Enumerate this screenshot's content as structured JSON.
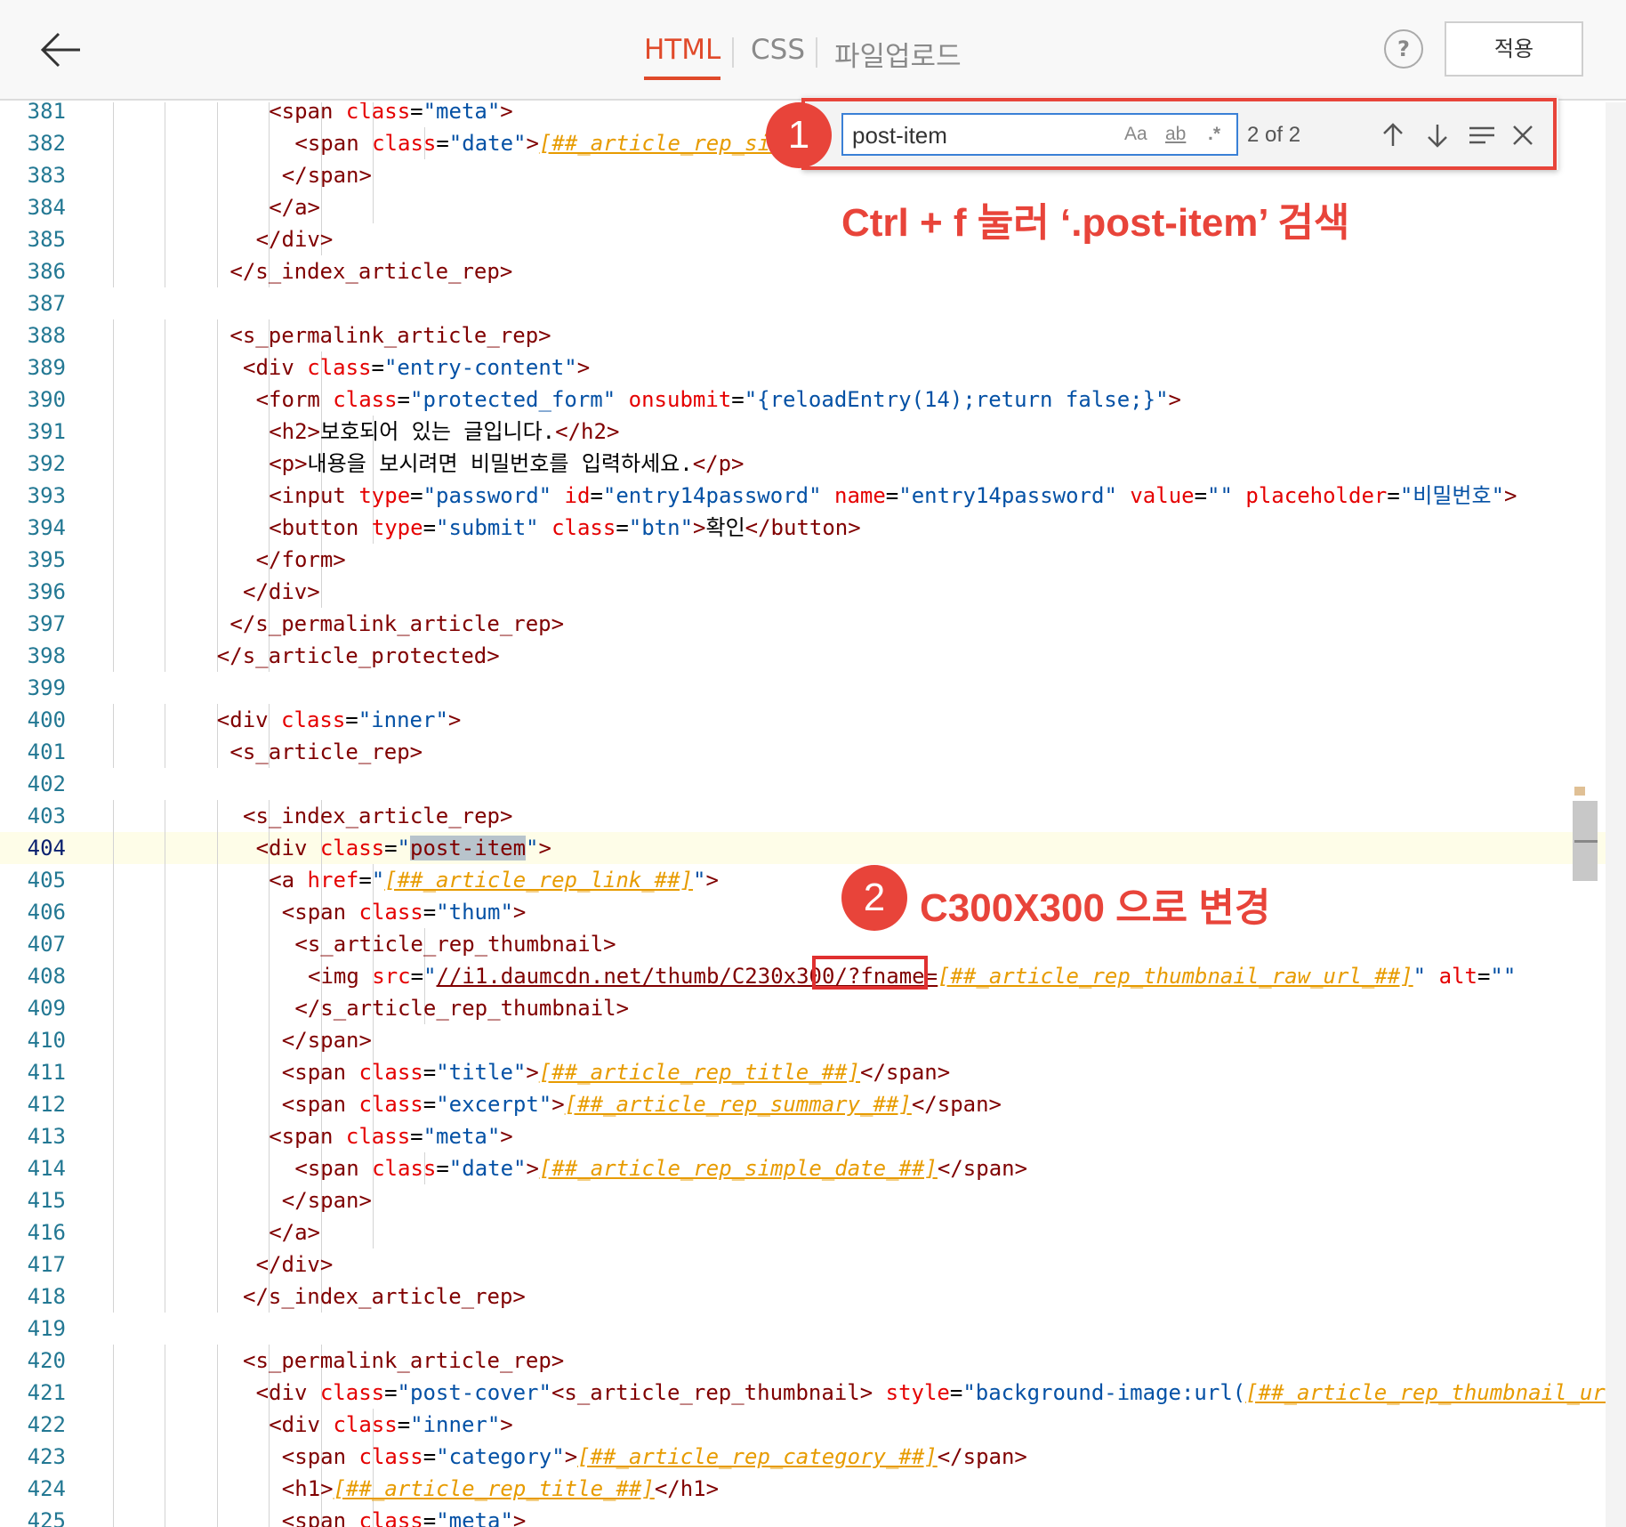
{
  "header": {
    "back_icon": "arrow-left-icon",
    "tabs": [
      {
        "label": "HTML",
        "active": true
      },
      {
        "label": "CSS",
        "active": false
      },
      {
        "label": "파일업로드",
        "active": false
      }
    ],
    "help_label": "?",
    "apply_label": "적용"
  },
  "find": {
    "query": "post-item",
    "match_case": "Aa",
    "whole_word": "ab",
    "regex": ".*",
    "count": "2 of 2",
    "icons": [
      "arrow-up-icon",
      "arrow-down-icon",
      "find-in-selection-icon",
      "close-icon"
    ]
  },
  "annotations": {
    "step1_number": "1",
    "step1_text": "Ctrl + f 눌러 ‘.post-item’ 검색",
    "step2_number": "2",
    "step2_text": "C300X300 으로 변경"
  },
  "editor": {
    "active_line": 404,
    "lines": [
      {
        "n": "381",
        "indent": 12,
        "tokens": [
          [
            "t",
            "<span "
          ],
          [
            "a",
            "class"
          ],
          [
            "p",
            "="
          ],
          [
            "s",
            "\"meta\""
          ],
          [
            "t",
            ">"
          ]
        ]
      },
      {
        "n": "382",
        "indent": 14,
        "tokens": [
          [
            "t",
            "<span "
          ],
          [
            "a",
            "class"
          ],
          [
            "p",
            "="
          ],
          [
            "s",
            "\"date\""
          ],
          [
            "t",
            ">"
          ],
          [
            "tp",
            "[##_article_rep_simple_date_##]"
          ],
          [
            "t",
            "</span>"
          ]
        ]
      },
      {
        "n": "383",
        "indent": 13,
        "tokens": [
          [
            "t",
            "</span>"
          ]
        ]
      },
      {
        "n": "384",
        "indent": 12,
        "tokens": [
          [
            "t",
            "</a>"
          ]
        ]
      },
      {
        "n": "385",
        "indent": 11,
        "tokens": [
          [
            "t",
            "</div>"
          ]
        ]
      },
      {
        "n": "386",
        "indent": 9,
        "tokens": [
          [
            "t",
            "</s_index_article_rep>"
          ]
        ]
      },
      {
        "n": "387",
        "indent": 0,
        "tokens": []
      },
      {
        "n": "388",
        "indent": 9,
        "tokens": [
          [
            "t",
            "<s_permalink_article_rep>"
          ]
        ]
      },
      {
        "n": "389",
        "indent": 10,
        "tokens": [
          [
            "t",
            "<div "
          ],
          [
            "a",
            "class"
          ],
          [
            "p",
            "="
          ],
          [
            "s",
            "\"entry-content\""
          ],
          [
            "t",
            ">"
          ]
        ]
      },
      {
        "n": "390",
        "indent": 11,
        "tokens": [
          [
            "t",
            "<form "
          ],
          [
            "a",
            "class"
          ],
          [
            "p",
            "="
          ],
          [
            "s",
            "\"protected_form\""
          ],
          [
            "p",
            " "
          ],
          [
            "a",
            "onsubmit"
          ],
          [
            "p",
            "="
          ],
          [
            "s",
            "\"{reloadEntry(14);return false;}\""
          ],
          [
            "t",
            ">"
          ]
        ]
      },
      {
        "n": "391",
        "indent": 12,
        "tokens": [
          [
            "t",
            "<h2>"
          ],
          [
            "p",
            "보호되어 있는 글입니다."
          ],
          [
            "t",
            "</h2>"
          ]
        ]
      },
      {
        "n": "392",
        "indent": 12,
        "tokens": [
          [
            "t",
            "<p>"
          ],
          [
            "p",
            "내용을 보시려면 비밀번호를 입력하세요."
          ],
          [
            "t",
            "</p>"
          ]
        ]
      },
      {
        "n": "393",
        "indent": 12,
        "tokens": [
          [
            "t",
            "<input "
          ],
          [
            "a",
            "type"
          ],
          [
            "p",
            "="
          ],
          [
            "s",
            "\"password\""
          ],
          [
            "p",
            " "
          ],
          [
            "a",
            "id"
          ],
          [
            "p",
            "="
          ],
          [
            "s",
            "\"entry14password\""
          ],
          [
            "p",
            " "
          ],
          [
            "a",
            "name"
          ],
          [
            "p",
            "="
          ],
          [
            "s",
            "\"entry14password\""
          ],
          [
            "p",
            " "
          ],
          [
            "a",
            "value"
          ],
          [
            "p",
            "="
          ],
          [
            "s",
            "\"\""
          ],
          [
            "p",
            " "
          ],
          [
            "a",
            "placeholder"
          ],
          [
            "p",
            "="
          ],
          [
            "s",
            "\"비밀번호\""
          ],
          [
            "t",
            ">"
          ]
        ]
      },
      {
        "n": "394",
        "indent": 12,
        "tokens": [
          [
            "t",
            "<button "
          ],
          [
            "a",
            "type"
          ],
          [
            "p",
            "="
          ],
          [
            "s",
            "\"submit\""
          ],
          [
            "p",
            " "
          ],
          [
            "a",
            "class"
          ],
          [
            "p",
            "="
          ],
          [
            "s",
            "\"btn\""
          ],
          [
            "t",
            ">"
          ],
          [
            "p",
            "확인"
          ],
          [
            "t",
            "</button>"
          ]
        ]
      },
      {
        "n": "395",
        "indent": 11,
        "tokens": [
          [
            "t",
            "</form>"
          ]
        ]
      },
      {
        "n": "396",
        "indent": 10,
        "tokens": [
          [
            "t",
            "</div>"
          ]
        ]
      },
      {
        "n": "397",
        "indent": 9,
        "tokens": [
          [
            "t",
            "</s_permalink_article_rep>"
          ]
        ]
      },
      {
        "n": "398",
        "indent": 8,
        "tokens": [
          [
            "t",
            "</s_article_protected>"
          ]
        ]
      },
      {
        "n": "399",
        "indent": 0,
        "tokens": []
      },
      {
        "n": "400",
        "indent": 8,
        "tokens": [
          [
            "t",
            "<div "
          ],
          [
            "a",
            "class"
          ],
          [
            "p",
            "="
          ],
          [
            "s",
            "\"inner\""
          ],
          [
            "t",
            ">"
          ]
        ]
      },
      {
        "n": "401",
        "indent": 9,
        "tokens": [
          [
            "t",
            "<s_article_rep>"
          ]
        ]
      },
      {
        "n": "402",
        "indent": 0,
        "tokens": []
      },
      {
        "n": "403",
        "indent": 10,
        "tokens": [
          [
            "t",
            "<s_index_article_rep>"
          ]
        ]
      },
      {
        "n": "404",
        "indent": 11,
        "tokens": [
          [
            "t",
            "<div "
          ],
          [
            "a",
            "class"
          ],
          [
            "p",
            "="
          ],
          [
            "s",
            "\""
          ],
          [
            "hl",
            "post-item"
          ],
          [
            "s",
            "\""
          ],
          [
            "t",
            ">"
          ]
        ]
      },
      {
        "n": "405",
        "indent": 12,
        "tokens": [
          [
            "t",
            "<a "
          ],
          [
            "a",
            "href"
          ],
          [
            "p",
            "="
          ],
          [
            "s",
            "\""
          ],
          [
            "tp",
            "[##_article_rep_link_##]"
          ],
          [
            "s",
            "\""
          ],
          [
            "t",
            ">"
          ]
        ]
      },
      {
        "n": "406",
        "indent": 13,
        "tokens": [
          [
            "t",
            "<span "
          ],
          [
            "a",
            "class"
          ],
          [
            "p",
            "="
          ],
          [
            "s",
            "\"thum\""
          ],
          [
            "t",
            ">"
          ]
        ]
      },
      {
        "n": "407",
        "indent": 14,
        "tokens": [
          [
            "t",
            "<s_article_rep_thumbnail>"
          ]
        ]
      },
      {
        "n": "408",
        "indent": 15,
        "tokens": [
          [
            "t",
            "<img "
          ],
          [
            "a",
            "src"
          ],
          [
            "p",
            "="
          ],
          [
            "s",
            "\""
          ],
          [
            "lnk",
            "//i1.daumcdn.net/thumb/C230x300/?fname="
          ],
          [
            "tp",
            "[##_article_rep_thumbnail_raw_url_##]"
          ],
          [
            "s",
            "\""
          ],
          [
            "p",
            " "
          ],
          [
            "a",
            "alt"
          ],
          [
            "p",
            "="
          ],
          [
            "s",
            "\"\""
          ]
        ]
      },
      {
        "n": "409",
        "indent": 14,
        "tokens": [
          [
            "t",
            "</s_article_rep_thumbnail>"
          ]
        ]
      },
      {
        "n": "410",
        "indent": 13,
        "tokens": [
          [
            "t",
            "</span>"
          ]
        ]
      },
      {
        "n": "411",
        "indent": 13,
        "tokens": [
          [
            "t",
            "<span "
          ],
          [
            "a",
            "class"
          ],
          [
            "p",
            "="
          ],
          [
            "s",
            "\"title\""
          ],
          [
            "t",
            ">"
          ],
          [
            "tp",
            "[##_article_rep_title_##]"
          ],
          [
            "t",
            "</span>"
          ]
        ]
      },
      {
        "n": "412",
        "indent": 13,
        "tokens": [
          [
            "t",
            "<span "
          ],
          [
            "a",
            "class"
          ],
          [
            "p",
            "="
          ],
          [
            "s",
            "\"excerpt\""
          ],
          [
            "t",
            ">"
          ],
          [
            "tp",
            "[##_article_rep_summary_##]"
          ],
          [
            "t",
            "</span>"
          ]
        ]
      },
      {
        "n": "413",
        "indent": 12,
        "tokens": [
          [
            "t",
            "<span "
          ],
          [
            "a",
            "class"
          ],
          [
            "p",
            "="
          ],
          [
            "s",
            "\"meta\""
          ],
          [
            "t",
            ">"
          ]
        ]
      },
      {
        "n": "414",
        "indent": 14,
        "tokens": [
          [
            "t",
            "<span "
          ],
          [
            "a",
            "class"
          ],
          [
            "p",
            "="
          ],
          [
            "s",
            "\"date\""
          ],
          [
            "t",
            ">"
          ],
          [
            "tp",
            "[##_article_rep_simple_date_##]"
          ],
          [
            "t",
            "</span>"
          ]
        ]
      },
      {
        "n": "415",
        "indent": 13,
        "tokens": [
          [
            "t",
            "</span>"
          ]
        ]
      },
      {
        "n": "416",
        "indent": 12,
        "tokens": [
          [
            "t",
            "</a>"
          ]
        ]
      },
      {
        "n": "417",
        "indent": 11,
        "tokens": [
          [
            "t",
            "</div>"
          ]
        ]
      },
      {
        "n": "418",
        "indent": 10,
        "tokens": [
          [
            "t",
            "</s_index_article_rep>"
          ]
        ]
      },
      {
        "n": "419",
        "indent": 0,
        "tokens": []
      },
      {
        "n": "420",
        "indent": 10,
        "tokens": [
          [
            "t",
            "<s_permalink_article_rep>"
          ]
        ]
      },
      {
        "n": "421",
        "indent": 11,
        "tokens": [
          [
            "t",
            "<div "
          ],
          [
            "a",
            "class"
          ],
          [
            "p",
            "="
          ],
          [
            "s",
            "\"post-cover\""
          ],
          [
            "t",
            "<s_article_rep_thumbnail>"
          ],
          [
            "p",
            " "
          ],
          [
            "a",
            "style"
          ],
          [
            "p",
            "="
          ],
          [
            "s",
            "\"background-image:url("
          ],
          [
            "tp",
            "[##_article_rep_thumbnail_url_##]"
          ]
        ]
      },
      {
        "n": "422",
        "indent": 12,
        "tokens": [
          [
            "t",
            "<div "
          ],
          [
            "a",
            "class"
          ],
          [
            "p",
            "="
          ],
          [
            "s",
            "\"inner\""
          ],
          [
            "t",
            ">"
          ]
        ]
      },
      {
        "n": "423",
        "indent": 13,
        "tokens": [
          [
            "t",
            "<span "
          ],
          [
            "a",
            "class"
          ],
          [
            "p",
            "="
          ],
          [
            "s",
            "\"category\""
          ],
          [
            "t",
            ">"
          ],
          [
            "tp",
            "[##_article_rep_category_##]"
          ],
          [
            "t",
            "</span>"
          ]
        ]
      },
      {
        "n": "424",
        "indent": 13,
        "tokens": [
          [
            "t",
            "<h1>"
          ],
          [
            "tp",
            "[##_article_rep_title_##]"
          ],
          [
            "t",
            "</h1>"
          ]
        ]
      },
      {
        "n": "425",
        "indent": 13,
        "tokens": [
          [
            "t",
            "<span "
          ],
          [
            "a",
            "class"
          ],
          [
            "p",
            "="
          ],
          [
            "s",
            "\"meta\""
          ],
          [
            "t",
            ">"
          ]
        ]
      }
    ]
  }
}
